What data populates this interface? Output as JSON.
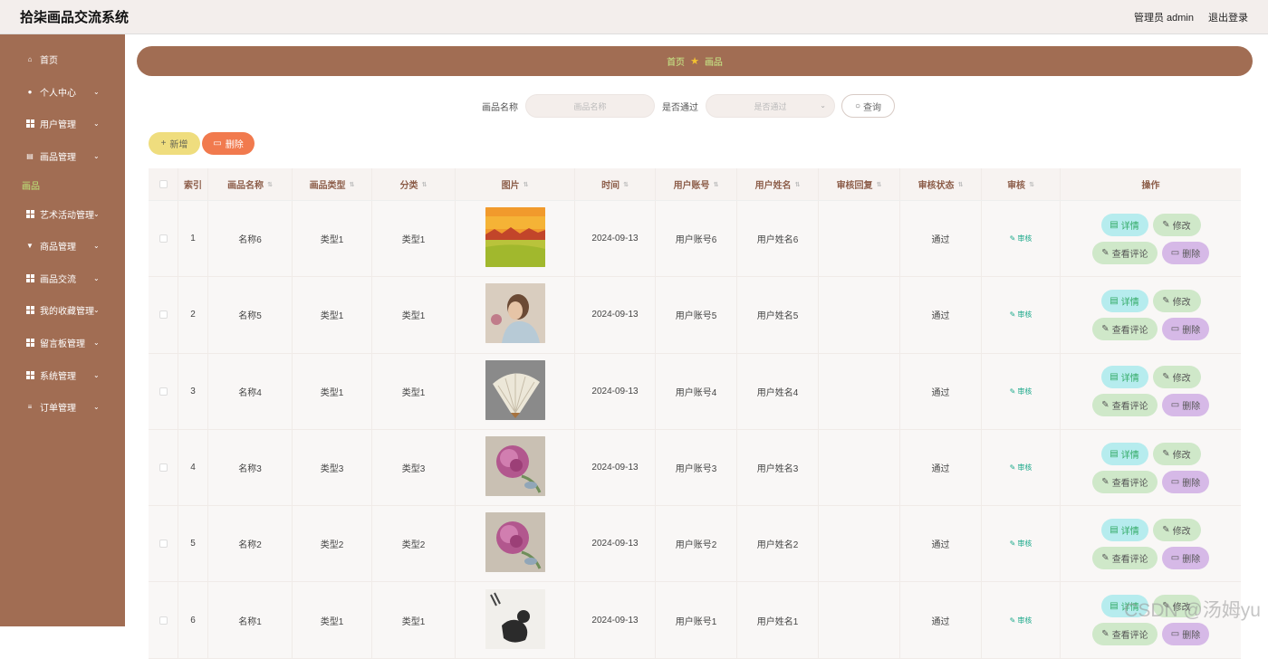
{
  "app": {
    "title": "拾柒画品交流系统",
    "user_label": "管理员 admin",
    "logout": "退出登录"
  },
  "sidebar": {
    "items": [
      {
        "label": "首页",
        "icon": "home-icon",
        "chevron": false
      },
      {
        "label": "个人中心",
        "icon": "user-icon",
        "chevron": true
      },
      {
        "label": "用户管理",
        "icon": "grid-icon",
        "chevron": true
      },
      {
        "label": "画品管理",
        "icon": "document-icon",
        "chevron": true
      },
      {
        "label": "画品",
        "icon": "",
        "chevron": false,
        "sub": true
      },
      {
        "label": "艺术活动管理",
        "icon": "grid-icon",
        "chevron": true
      },
      {
        "label": "商品管理",
        "icon": "shop-icon",
        "chevron": true
      },
      {
        "label": "画品交流",
        "icon": "grid-icon",
        "chevron": true
      },
      {
        "label": "我的收藏管理",
        "icon": "grid-icon",
        "chevron": true
      },
      {
        "label": "留言板管理",
        "icon": "grid-icon",
        "chevron": true
      },
      {
        "label": "系统管理",
        "icon": "grid-icon",
        "chevron": true
      },
      {
        "label": "订单管理",
        "icon": "list-icon",
        "chevron": true
      }
    ]
  },
  "breadcrumb": {
    "home": "首页",
    "current": "画品"
  },
  "search": {
    "name_label": "画品名称",
    "name_placeholder": "画品名称",
    "pass_label": "是否通过",
    "pass_placeholder": "是否通过",
    "query": "查询"
  },
  "actions": {
    "add": "新增",
    "delete": "删除"
  },
  "table": {
    "headers": [
      "索引",
      "画品名称",
      "画品类型",
      "分类",
      "图片",
      "时间",
      "用户账号",
      "用户姓名",
      "审核回复",
      "审核状态",
      "审核",
      "操作"
    ],
    "rows": [
      {
        "index": "1",
        "name": "名称6",
        "type": "类型1",
        "category": "类型1",
        "image": "sunset-landscape-painting",
        "time": "2024-09-13",
        "account": "用户账号6",
        "username": "用户姓名6",
        "reply": "",
        "status": "通过"
      },
      {
        "index": "2",
        "name": "名称5",
        "type": "类型1",
        "category": "类型1",
        "image": "lady-portrait-painting",
        "time": "2024-09-13",
        "account": "用户账号5",
        "username": "用户姓名5",
        "reply": "",
        "status": "通过"
      },
      {
        "index": "3",
        "name": "名称4",
        "type": "类型1",
        "category": "类型1",
        "image": "folding-fan-painting",
        "time": "2024-09-13",
        "account": "用户账号4",
        "username": "用户姓名4",
        "reply": "",
        "status": "通过"
      },
      {
        "index": "4",
        "name": "名称3",
        "type": "类型3",
        "category": "类型3",
        "image": "peony-painting",
        "time": "2024-09-13",
        "account": "用户账号3",
        "username": "用户姓名3",
        "reply": "",
        "status": "通过"
      },
      {
        "index": "5",
        "name": "名称2",
        "type": "类型2",
        "category": "类型2",
        "image": "peony-painting",
        "time": "2024-09-13",
        "account": "用户账号2",
        "username": "用户姓名2",
        "reply": "",
        "status": "通过"
      },
      {
        "index": "6",
        "name": "名称1",
        "type": "类型1",
        "category": "类型1",
        "image": "ink-cat-painting",
        "time": "2024-09-13",
        "account": "用户账号1",
        "username": "用户姓名1",
        "reply": "",
        "status": "通过"
      }
    ],
    "audit_label": "审核",
    "op_labels": {
      "detail": "详情",
      "edit": "修改",
      "comment": "查看评论",
      "delete": "删除"
    }
  },
  "watermark": "CSDN @汤姆yu",
  "colors": {
    "sidebar": "#a16d53",
    "breadcrumb": "#a16d53",
    "breadcrumb_text": "#c9f08a",
    "add_button": "#efdd7e",
    "delete_button": "#f17a4e",
    "detail_button": "#b6ecee",
    "edit_button": "#cfe8c9",
    "op_delete_button": "#d6b9e7",
    "audit_text": "#1aa88a"
  }
}
